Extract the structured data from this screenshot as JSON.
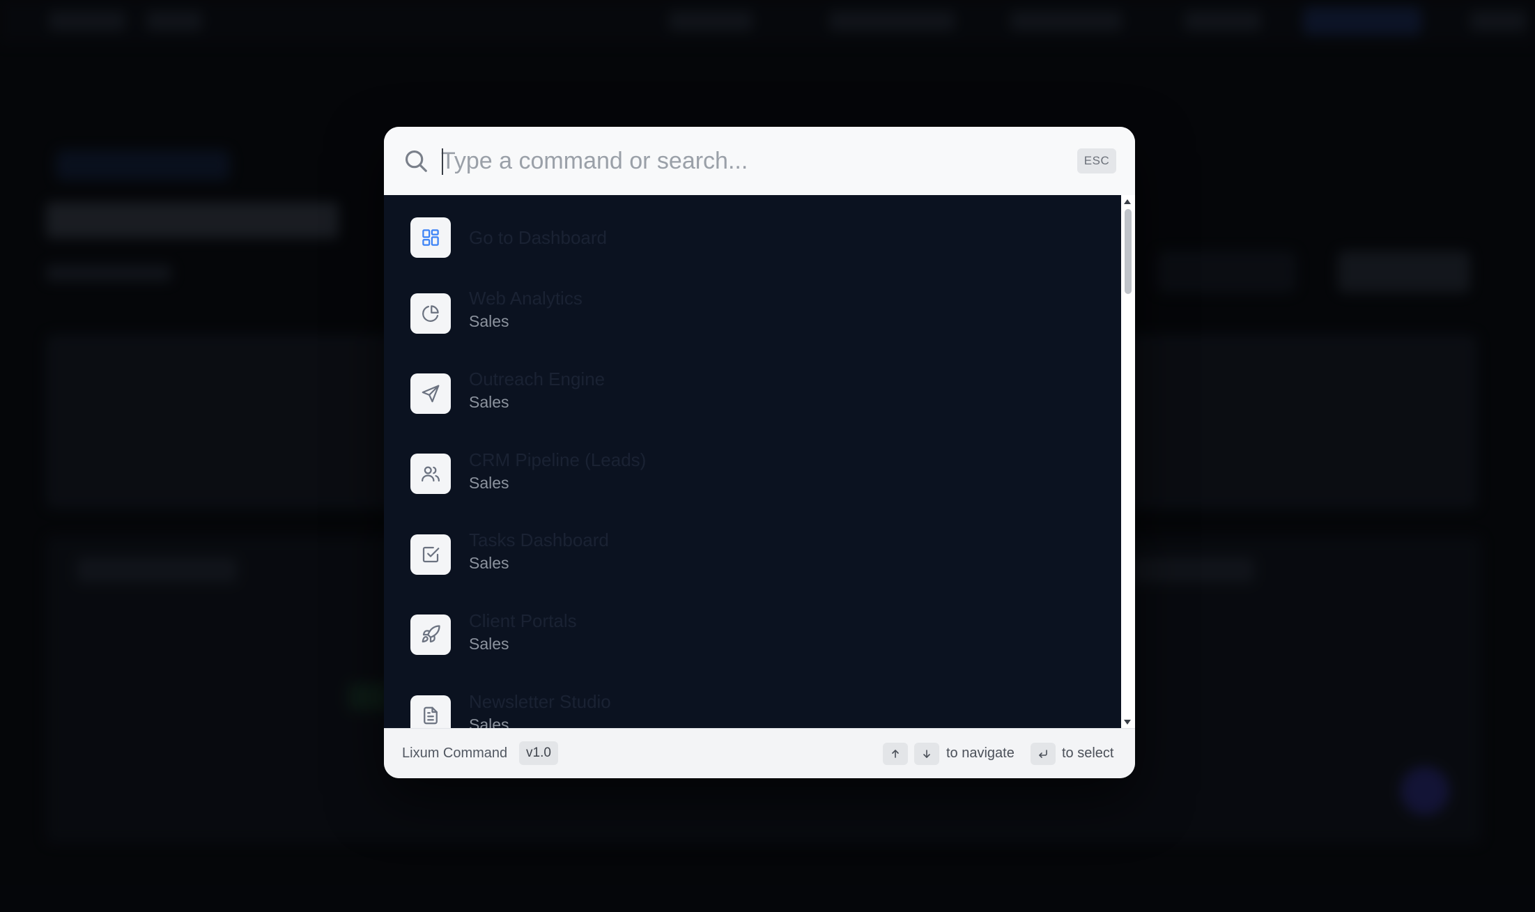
{
  "search": {
    "placeholder": "Type a command or search...",
    "esc_label": "ESC"
  },
  "results": [
    {
      "title": "Go to Dashboard",
      "subtitle": "",
      "icon": "dashboard-grid-icon"
    },
    {
      "title": "Web Analytics",
      "subtitle": "Sales",
      "icon": "pie-chart-icon"
    },
    {
      "title": "Outreach Engine",
      "subtitle": "Sales",
      "icon": "send-icon"
    },
    {
      "title": "CRM Pipeline (Leads)",
      "subtitle": "Sales",
      "icon": "users-icon"
    },
    {
      "title": "Tasks Dashboard",
      "subtitle": "Sales",
      "icon": "checkbox-icon"
    },
    {
      "title": "Client Portals",
      "subtitle": "Sales",
      "icon": "rocket-icon"
    },
    {
      "title": "Newsletter Studio",
      "subtitle": "Sales",
      "icon": "file-text-icon"
    }
  ],
  "footer": {
    "brand": "Lixum Command",
    "version": "v1.0",
    "navigate_hint": "to navigate",
    "select_hint": "to select"
  },
  "colors": {
    "accent": "#3b82f6",
    "results_bg": "#0b1220",
    "modal_bg": "#f7f8fa"
  }
}
